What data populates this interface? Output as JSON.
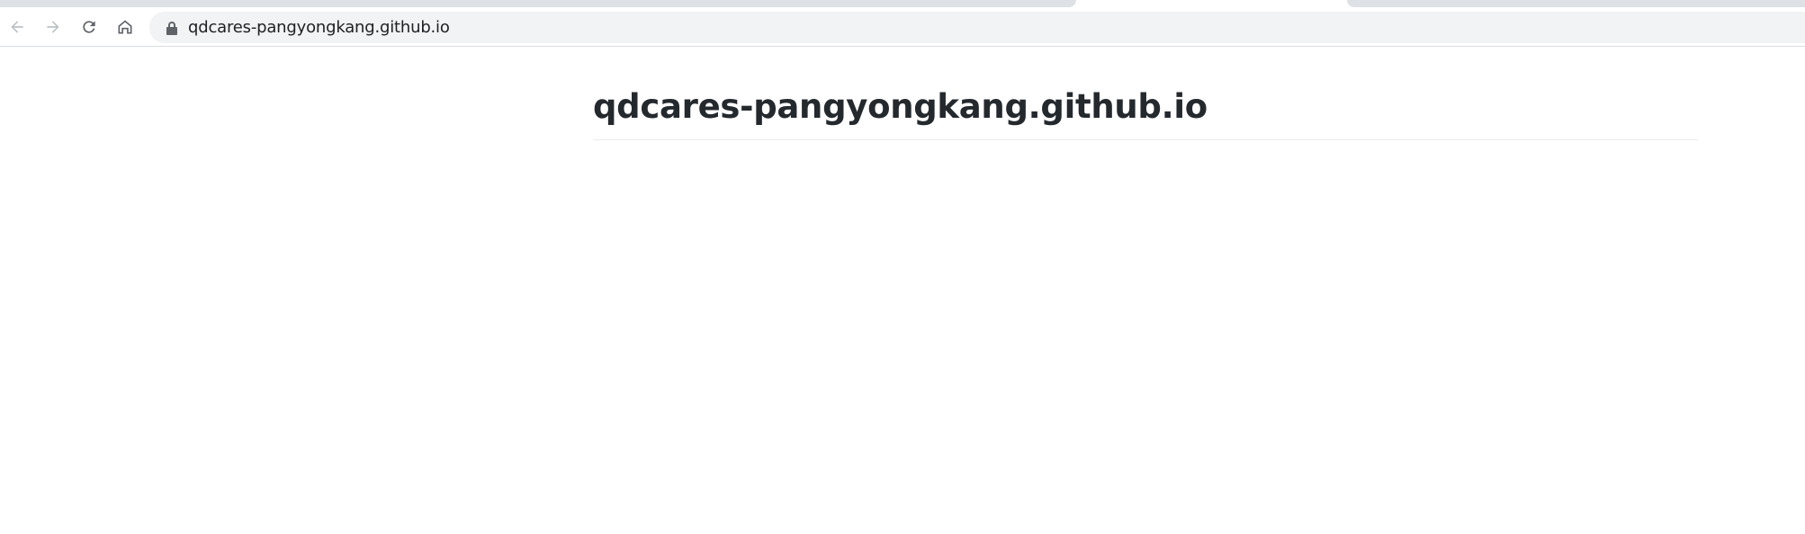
{
  "browser": {
    "address_bar": {
      "url": "qdcares-pangyongkang.github.io",
      "secure": true
    },
    "nav": {
      "back_enabled": false,
      "forward_enabled": false
    }
  },
  "page": {
    "heading": "qdcares-pangyongkang.github.io"
  },
  "colors": {
    "heading": "#24292e",
    "omnibox_bg": "#f1f3f4",
    "tab_inactive": "#dee1e6",
    "icon": "#5f6368",
    "icon_disabled": "#bdc1c6"
  },
  "icons": {
    "back": "arrow-left-icon",
    "forward": "arrow-right-icon",
    "reload": "reload-icon",
    "home": "home-icon",
    "lock": "lock-icon"
  }
}
